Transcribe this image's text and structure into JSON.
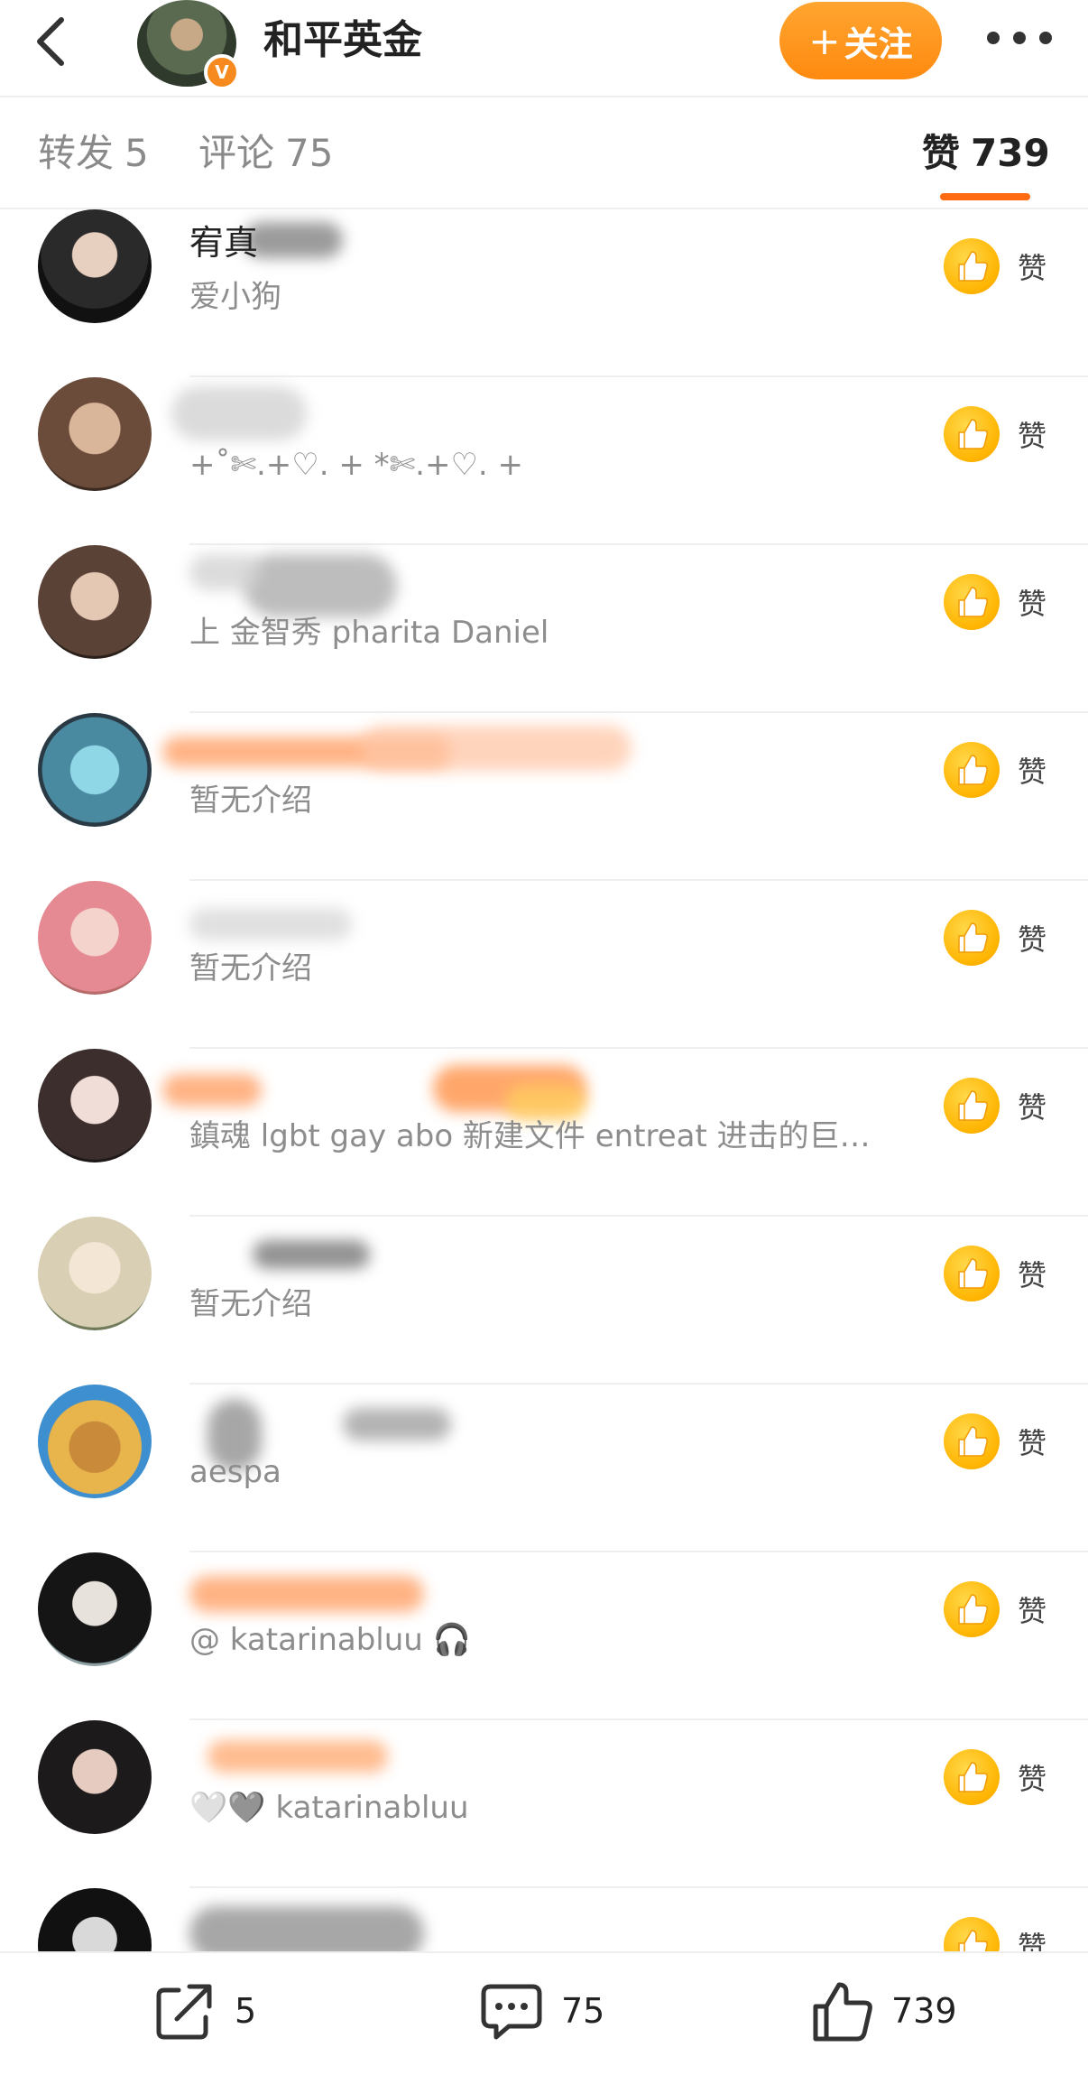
{
  "header": {
    "author_name": "和平英金",
    "follow_label": "关注",
    "follow_plus": "+"
  },
  "tabs": [
    {
      "label": "转发",
      "count": "5"
    },
    {
      "label": "评论",
      "count": "75"
    },
    {
      "label": "赞",
      "count": "739"
    }
  ],
  "active_tab": "赞",
  "like_button_label": "赞",
  "likers": [
    {
      "nickname": "宥真",
      "bio": "爱小狗"
    },
    {
      "nickname": "",
      "bio": "+˚✄.+♡. + *✄.+♡. +"
    },
    {
      "nickname": "",
      "bio": "上 金智秀 pharita Daniel"
    },
    {
      "nickname": "",
      "bio": "暂无介绍"
    },
    {
      "nickname": "",
      "bio": "暂无介绍"
    },
    {
      "nickname": "",
      "bio": "鎮魂 lgbt gay abo 新建文件 entreat 进击的巨…"
    },
    {
      "nickname": "",
      "bio": "暂无介绍"
    },
    {
      "nickname": "",
      "bio": "aespa"
    },
    {
      "nickname": "",
      "bio": "@ katarinabluu 🎧"
    },
    {
      "nickname": "",
      "bio": "🤍🩶 katarinabluu"
    },
    {
      "nickname": "",
      "bio": ""
    }
  ],
  "bottom_bar": {
    "repost_count": "5",
    "comment_count": "75",
    "like_count": "739"
  },
  "colors": {
    "accent": "#ff8a10",
    "tab_underline": "#ff6a13",
    "like_thumb": "#ffb400",
    "secondary_text": "#8d8d8d"
  },
  "icons": {
    "back": "chevron-left-icon",
    "more": "more-dots-icon",
    "verified": "verified-badge-icon",
    "like": "thumbs-up-icon",
    "repost": "share-arrow-icon",
    "comment": "comment-bubble-icon"
  }
}
